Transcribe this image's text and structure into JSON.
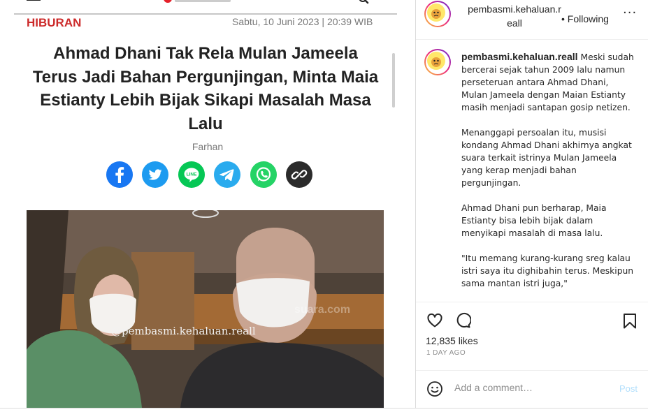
{
  "article": {
    "category": "HIBURAN",
    "date": "Sabtu, 10 Juni 2023 | 20:39 WIB",
    "title_lines": [
      "Ahmad Dhani Tak Rela Mulan Jameela",
      "Terus Jadi Bahan Pergunjingan, Minta Maia",
      "Estianty Lebih Bijak Sikapi Masalah Masa",
      "Lalu"
    ],
    "author": "Farhan",
    "share_icons": [
      "facebook-icon",
      "twitter-icon",
      "line-icon",
      "telegram-icon",
      "whatsapp-icon",
      "copy-link-icon"
    ],
    "photo_watermark": "@pembasmi.kehaluan.reall",
    "photo_source_mark": "suara.com"
  },
  "post": {
    "username_line1": "pembasmi.kehaluan.r",
    "username_line2": "eall",
    "follow_label": "Following",
    "more_label": "···",
    "caption_user": "pembasmi.kehaluan.reall",
    "caption_paragraphs": [
      "Meski sudah bercerai sejak tahun 2009 lalu namun perseteruan antara Ahmad Dhani, Mulan Jameela dengan Maian Estianty masih menjadi santapan gosip netizen.",
      "Menanggapi persoalan itu, musisi kondang Ahmad Dhani akhirnya angkat suara terkait istrinya Mulan Jameela yang kerap menjadi bahan pergunjingan.",
      "Ahmad Dhani pun berharap, Maia Estianty bisa lebih bijak dalam menyikapi masalah di masa lalu.",
      "\"Itu memang kurang-kurang sreg kalau istri saya itu dighibahin terus. Meskipun sama mantan istri juga,\""
    ],
    "likes": "12,835 likes",
    "time_ago": "1 DAY AGO",
    "comment_placeholder": "Add a comment…",
    "post_button": "Post"
  },
  "colors": {
    "category_red": "#cc2a2a",
    "facebook": "#1877f2",
    "twitter": "#1d9bf0",
    "line": "#06c755",
    "telegram": "#2aabee",
    "whatsapp": "#25d366",
    "link": "#2b2b2b",
    "post_button": "#b2dffc"
  }
}
